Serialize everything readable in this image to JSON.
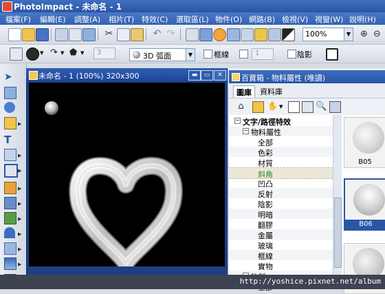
{
  "app": {
    "title": "PhotoImpact - 未命名 - 1"
  },
  "menu": [
    "檔案(F)",
    "編輯(E)",
    "調整(A)",
    "相片(T)",
    "特效(C)",
    "選取區(L)",
    "物件(O)",
    "網路(B)",
    "檢視(V)",
    "視窗(W)",
    "說明(H)"
  ],
  "toolbar": {
    "zoom": "100%"
  },
  "attr_toolbar": {
    "bevel_value": "3",
    "bevel_mode": "3D 弧面",
    "border_label": "框線",
    "border_value": "1",
    "shadow_label": "陰影"
  },
  "document": {
    "title": "未命名 - 1 (100%) 320x300"
  },
  "right_panel": {
    "title": "百寶箱 - 物料屬性 (唯讀)",
    "tabs": [
      "圖庫",
      "資料庫"
    ],
    "tree": [
      {
        "label": "文字/路徑特效",
        "level": 0,
        "expander": "−",
        "bold": true
      },
      {
        "label": "物料屬性",
        "level": 1,
        "expander": "−"
      },
      {
        "label": "全部",
        "level": 2
      },
      {
        "label": "色彩",
        "level": 2
      },
      {
        "label": "材質",
        "level": 2
      },
      {
        "label": "斜角",
        "level": 2,
        "selected": true
      },
      {
        "label": "凹凸",
        "level": 2
      },
      {
        "label": "反射",
        "level": 2
      },
      {
        "label": "陰影",
        "level": 2
      },
      {
        "label": "明暗",
        "level": 2
      },
      {
        "label": "翻膠",
        "level": 2
      },
      {
        "label": "金屬",
        "level": 2
      },
      {
        "label": "玻璃",
        "level": 2
      },
      {
        "label": "框線",
        "level": 2
      },
      {
        "label": "實物",
        "level": 2
      },
      {
        "label": "物料",
        "level": 1,
        "expander": "−"
      },
      {
        "label": "全部",
        "level": 2
      }
    ],
    "thumbnails": [
      {
        "caption": "B05",
        "selected": false
      },
      {
        "caption": "B06",
        "selected": true
      },
      {
        "caption": "",
        "selected": false
      }
    ]
  },
  "status": {
    "url": "http://yoshice.pixnet.net/album"
  }
}
